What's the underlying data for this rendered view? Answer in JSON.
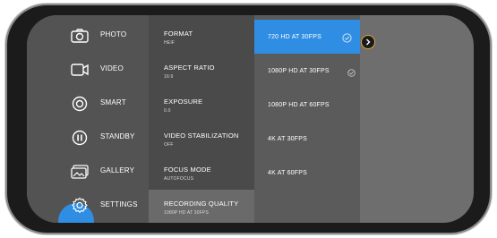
{
  "menu": {
    "items": [
      {
        "label": "PHOTO",
        "icon": "camera-icon"
      },
      {
        "label": "VIDEO",
        "icon": "video-icon"
      },
      {
        "label": "SMART",
        "icon": "smart-icon"
      },
      {
        "label": "STANDBY",
        "icon": "pause-icon"
      },
      {
        "label": "GALLERY",
        "icon": "gallery-icon"
      },
      {
        "label": "SETTINGS",
        "icon": "settings-icon"
      }
    ],
    "selected": "SETTINGS"
  },
  "settings": {
    "items": [
      {
        "title": "FORMAT",
        "value": "HEIF"
      },
      {
        "title": "ASPECT RATIO",
        "value": "16:9"
      },
      {
        "title": "EXPOSURE",
        "value": "0.0"
      },
      {
        "title": "VIDEO STABILIZATION",
        "value": "OFF"
      },
      {
        "title": "FOCUS MODE",
        "value": "AUTOFOCUS"
      },
      {
        "title": "RECORDING QUALITY",
        "value": "1080P HD AT 30FPS"
      }
    ],
    "active": "RECORDING QUALITY"
  },
  "options": {
    "items": [
      {
        "label": "720 HD AT 30FPS"
      },
      {
        "label": "1080P HD AT 30FPS"
      },
      {
        "label": "1080P HD AT 60FPS"
      },
      {
        "label": "4K AT 30FPS"
      },
      {
        "label": "4K AT 60FPS"
      }
    ],
    "highlighted": "720 HD AT 30FPS",
    "checked": "1080P HD AT 30FPS"
  },
  "colors": {
    "accent": "#2f8ee3",
    "focus_ring": "#e3a33a"
  }
}
